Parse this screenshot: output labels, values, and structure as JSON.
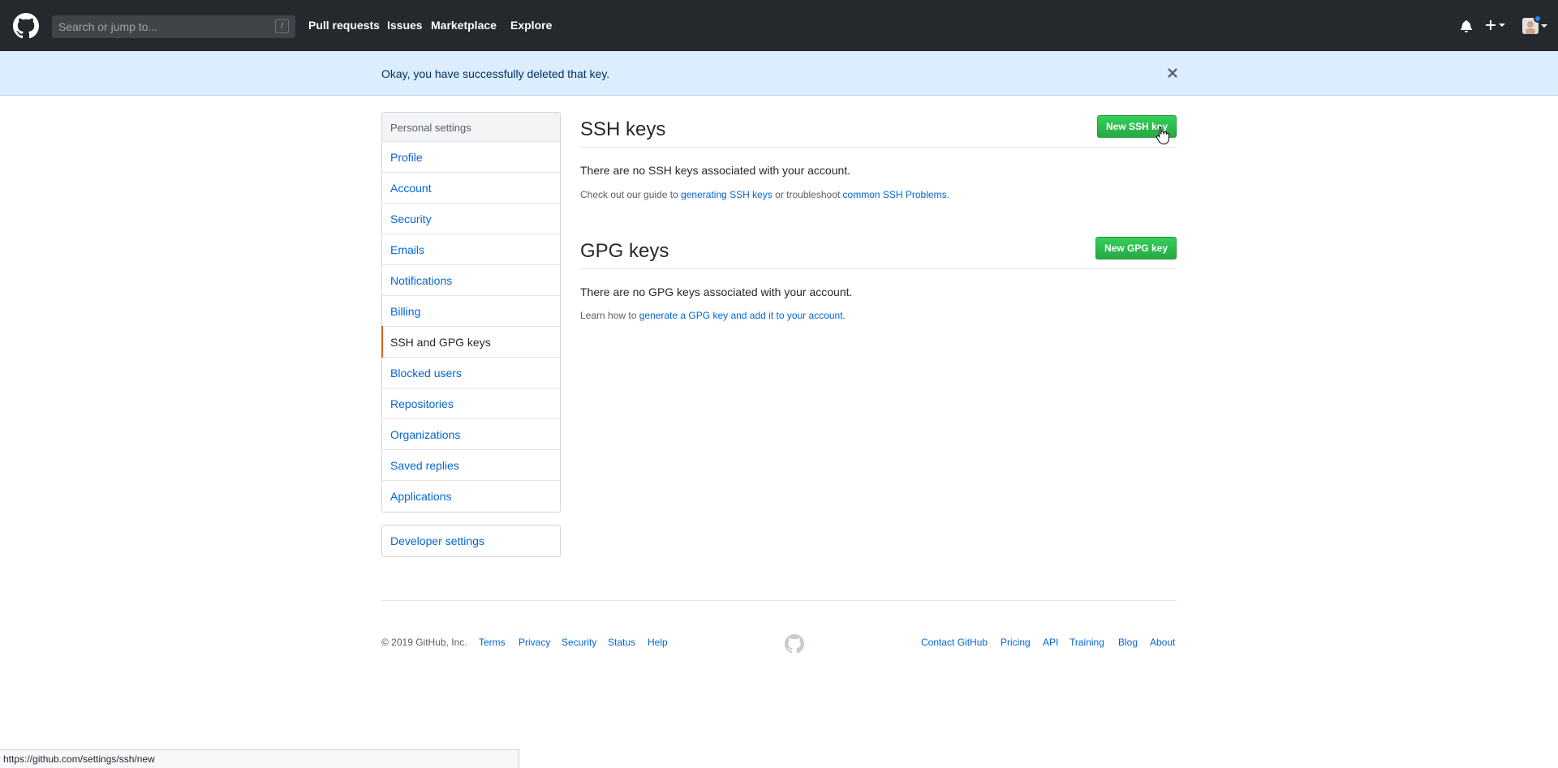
{
  "header": {
    "search_placeholder": "Search or jump to...",
    "search_shortcut": "/",
    "nav": [
      "Pull requests",
      "Issues",
      "Marketplace",
      "Explore"
    ]
  },
  "flash": {
    "message": "Okay, you have successfully deleted that key."
  },
  "sidebar": {
    "heading": "Personal settings",
    "items": [
      "Profile",
      "Account",
      "Security",
      "Emails",
      "Notifications",
      "Billing",
      "SSH and GPG keys",
      "Blocked users",
      "Repositories",
      "Organizations",
      "Saved replies",
      "Applications"
    ],
    "selected": "SSH and GPG keys",
    "developer_settings": "Developer settings"
  },
  "ssh": {
    "title": "SSH keys",
    "button": "New SSH key",
    "empty": "There are no SSH keys associated with your account.",
    "note_prefix": "Check out our guide to ",
    "link1": "generating SSH keys",
    "note_middle": " or troubleshoot ",
    "link2": "common SSH Problems",
    "note_suffix": "."
  },
  "gpg": {
    "title": "GPG keys",
    "button": "New GPG key",
    "empty": "There are no GPG keys associated with your account.",
    "note_prefix": "Learn how to ",
    "link": "generate a GPG key and add it to your account",
    "note_suffix": "."
  },
  "footer": {
    "copyright": "© 2019 GitHub, Inc.",
    "left_links": [
      "Terms",
      "Privacy",
      "Security",
      "Status",
      "Help"
    ],
    "right_links": [
      "Contact GitHub",
      "Pricing",
      "API",
      "Training",
      "Blog",
      "About"
    ]
  },
  "status_bar": {
    "url": "https://github.com/settings/ssh/new"
  },
  "colors": {
    "header_bg": "#24292e",
    "flash_bg": "#dbedff",
    "link": "#0366d6",
    "button_green": "#28a745",
    "selected_accent": "#e36209"
  }
}
